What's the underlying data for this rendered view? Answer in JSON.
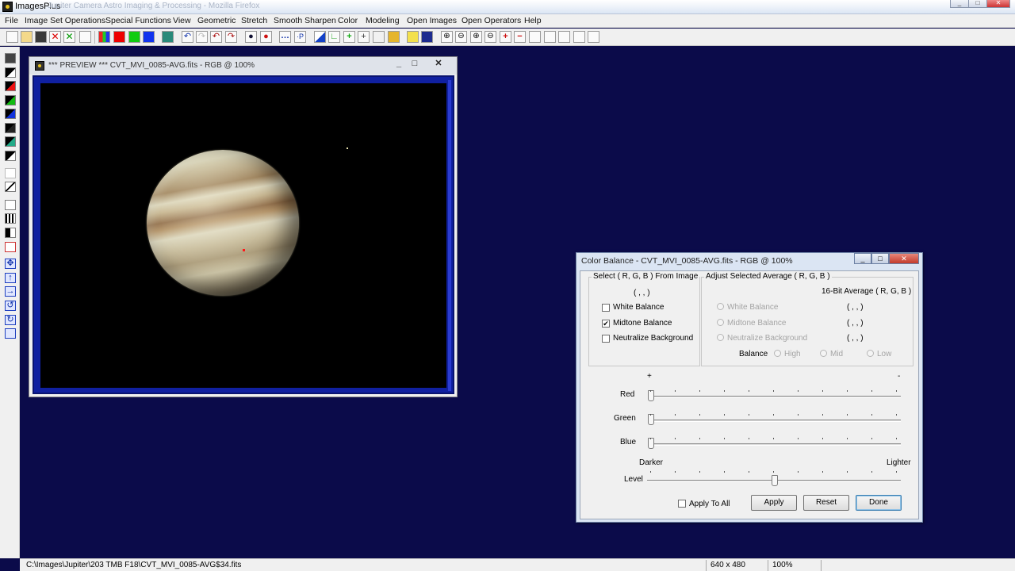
{
  "app": {
    "title": "ImagesPlus",
    "background_title": "Jupiter Camera Astro Imaging & Processing - Mozilla Firefox"
  },
  "menu": [
    "File",
    "Image Set Operations",
    "Special Functions",
    "View",
    "Geometric",
    "Stretch",
    "Smooth Sharpen",
    "Color",
    "Modeling",
    "Open Images",
    "Open Operators",
    "Help"
  ],
  "toolbar_icons": [
    "new-icon",
    "open-icon",
    "save-icon",
    "close-icon",
    "cancel-icon",
    "copy-icon",
    "rgb-channels-icon",
    "red-channel-icon",
    "green-channel-icon",
    "blue-channel-icon",
    "grid-icon",
    "undo-icon",
    "redo-icon",
    "undo-all-icon",
    "redo-all-icon",
    "record-icon",
    "record-red-icon",
    "dots-icon",
    "subpixel-icon",
    "levels-icon",
    "curves-icon",
    "plus-icon",
    "crosshair-icon",
    "table-icon",
    "brush-icon",
    "pencil-icon",
    "matrix-icon",
    "zoom-in-icon",
    "zoom-out-icon",
    "zoom-fit-icon",
    "zoom-reset-icon",
    "add-icon",
    "subtract-icon",
    "frame1-icon",
    "frame2-icon",
    "frame3-icon",
    "frame4-icon",
    "frame5-icon"
  ],
  "preview": {
    "title": "*** PREVIEW *** CVT_MVI_0085-AVG.fits - RGB @ 100%",
    "min": "_",
    "max": "□",
    "close": "✕"
  },
  "dialog": {
    "title": "Color Balance - CVT_MVI_0085-AVG.fits - RGB @ 100%",
    "select_group": {
      "label": "Select ( R, G, B ) From Image",
      "value": "( , , )",
      "options": [
        {
          "label": "White Balance",
          "checked": false
        },
        {
          "label": "Midtone Balance",
          "checked": true
        },
        {
          "label": "Neutralize Background",
          "checked": false
        }
      ]
    },
    "adjust_group": {
      "label": "Adjust Selected Average ( R, G, B )",
      "avg_header": "16-Bit Average ( R, G, B )",
      "rows": [
        {
          "label": "White Balance",
          "value": "( , , )"
        },
        {
          "label": "Midtone Balance",
          "value": "( , , )"
        },
        {
          "label": "Neutralize Background",
          "value": "( , , )"
        }
      ],
      "balance_label": "Balance",
      "balance_options": [
        "High",
        "Mid",
        "Low"
      ]
    },
    "sliders": {
      "plus": "+",
      "minus": "-",
      "red": "Red",
      "green": "Green",
      "blue": "Blue",
      "darker": "Darker",
      "lighter": "Lighter",
      "level": "Level",
      "red_value": 0,
      "green_value": 0,
      "blue_value": 0,
      "level_value": 0.5
    },
    "apply_to_all": "Apply To All",
    "apply_to_all_checked": false,
    "buttons": {
      "apply": "Apply",
      "reset": "Reset",
      "done": "Done"
    }
  },
  "status": {
    "path": "C:\\Images\\Jupiter\\203 TMB F18\\CVT_MVI_0085-AVG$34.fits",
    "dimensions": "640 x 480",
    "zoom": "100%"
  },
  "colors": {
    "workspace": "#0b0b4a",
    "preview_frame": "#1020a0",
    "dialog_border": "#6f84a8"
  }
}
